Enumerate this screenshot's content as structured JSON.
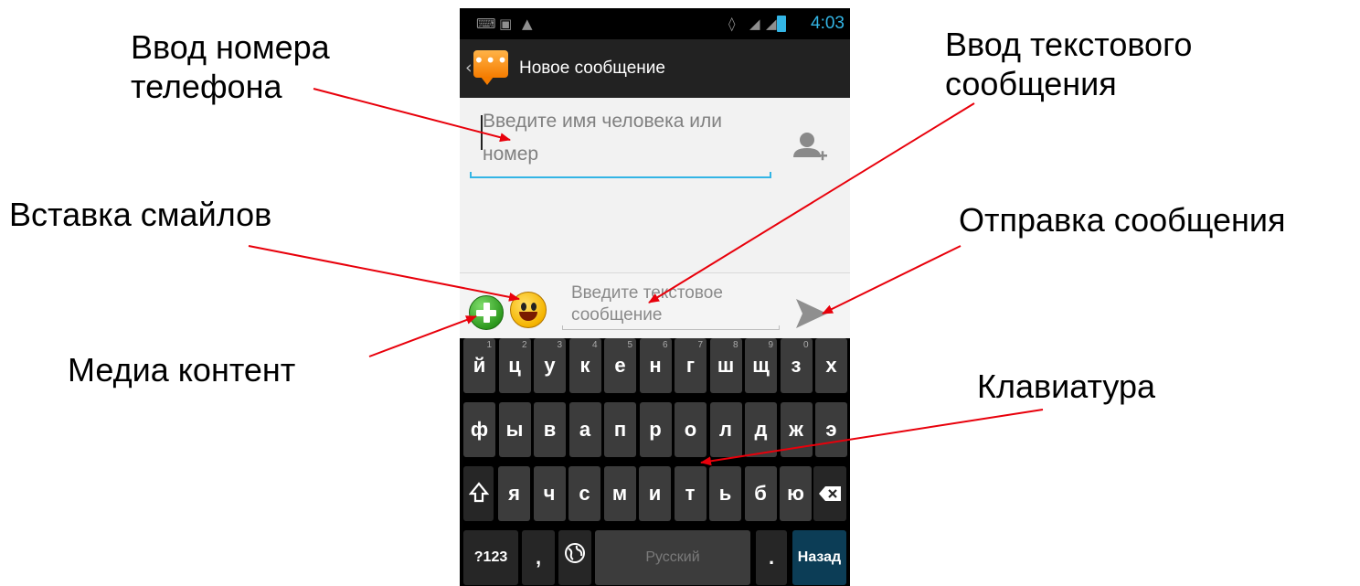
{
  "annotations": {
    "phone_input": [
      "Ввод номера",
      "телефона"
    ],
    "text_input": [
      "Ввод текстового",
      "сообщения"
    ],
    "smileys": "Вставка смайлов",
    "send": "Отправка сообщения",
    "media": "Медиа контент",
    "keyboard": "Клавиатура"
  },
  "colors": {
    "accent": "#33b5e5",
    "arrow": "#e8000b",
    "keyboard_bg": "#000000",
    "key": "#3c3c3c",
    "enter_key": "#0c3d56"
  },
  "status_bar": {
    "time": "4:03",
    "icons": [
      "keyboard-icon",
      "image-icon",
      "warning-icon",
      "vibrate-icon",
      "signal-icon",
      "signal-icon",
      "battery-icon"
    ]
  },
  "action_bar": {
    "title": "Новое сообщение"
  },
  "recipient": {
    "placeholder": "Введите имя человека или номер"
  },
  "compose": {
    "placeholder": "Введите текстовое сообщение"
  },
  "keyboard": {
    "row1": [
      {
        "label": "й",
        "hint": "1"
      },
      {
        "label": "ц",
        "hint": "2"
      },
      {
        "label": "у",
        "hint": "3"
      },
      {
        "label": "к",
        "hint": "4"
      },
      {
        "label": "е",
        "hint": "5"
      },
      {
        "label": "н",
        "hint": "6"
      },
      {
        "label": "г",
        "hint": "7"
      },
      {
        "label": "ш",
        "hint": "8"
      },
      {
        "label": "щ",
        "hint": "9"
      },
      {
        "label": "з",
        "hint": "0"
      },
      {
        "label": "х",
        "hint": ""
      }
    ],
    "row2": [
      "ф",
      "ы",
      "в",
      "а",
      "п",
      "р",
      "о",
      "л",
      "д",
      "ж",
      "э"
    ],
    "row3": [
      "я",
      "ч",
      "с",
      "м",
      "и",
      "т",
      "ь",
      "б",
      "ю"
    ],
    "row4": {
      "symbols": "?123",
      "comma": ",",
      "space": "Русский",
      "period": ".",
      "enter": "Назад"
    }
  }
}
